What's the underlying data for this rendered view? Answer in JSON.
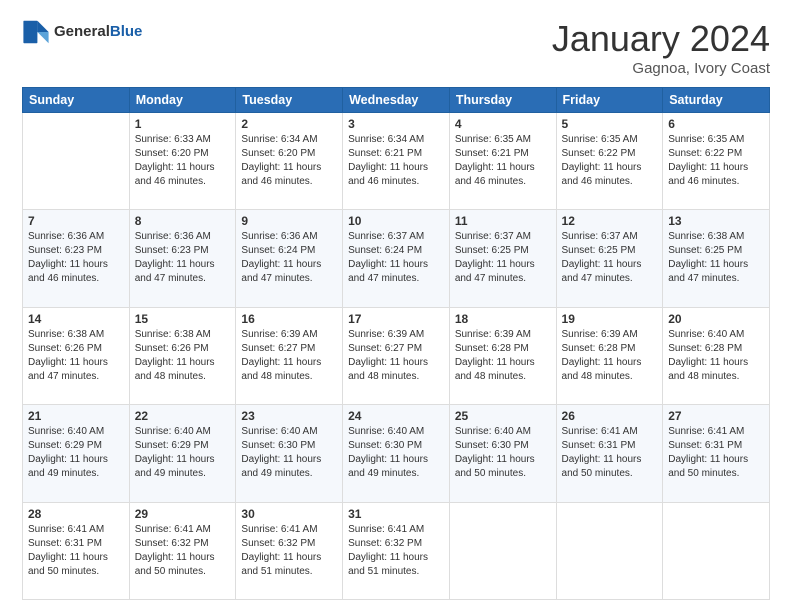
{
  "header": {
    "logo_general": "General",
    "logo_blue": "Blue",
    "title": "January 2024",
    "location": "Gagnoa, Ivory Coast"
  },
  "weekdays": [
    "Sunday",
    "Monday",
    "Tuesday",
    "Wednesday",
    "Thursday",
    "Friday",
    "Saturday"
  ],
  "weeks": [
    [
      {
        "day": "",
        "info": ""
      },
      {
        "day": "1",
        "info": "Sunrise: 6:33 AM\nSunset: 6:20 PM\nDaylight: 11 hours\nand 46 minutes."
      },
      {
        "day": "2",
        "info": "Sunrise: 6:34 AM\nSunset: 6:20 PM\nDaylight: 11 hours\nand 46 minutes."
      },
      {
        "day": "3",
        "info": "Sunrise: 6:34 AM\nSunset: 6:21 PM\nDaylight: 11 hours\nand 46 minutes."
      },
      {
        "day": "4",
        "info": "Sunrise: 6:35 AM\nSunset: 6:21 PM\nDaylight: 11 hours\nand 46 minutes."
      },
      {
        "day": "5",
        "info": "Sunrise: 6:35 AM\nSunset: 6:22 PM\nDaylight: 11 hours\nand 46 minutes."
      },
      {
        "day": "6",
        "info": "Sunrise: 6:35 AM\nSunset: 6:22 PM\nDaylight: 11 hours\nand 46 minutes."
      }
    ],
    [
      {
        "day": "7",
        "info": "Sunrise: 6:36 AM\nSunset: 6:23 PM\nDaylight: 11 hours\nand 46 minutes."
      },
      {
        "day": "8",
        "info": "Sunrise: 6:36 AM\nSunset: 6:23 PM\nDaylight: 11 hours\nand 47 minutes."
      },
      {
        "day": "9",
        "info": "Sunrise: 6:36 AM\nSunset: 6:24 PM\nDaylight: 11 hours\nand 47 minutes."
      },
      {
        "day": "10",
        "info": "Sunrise: 6:37 AM\nSunset: 6:24 PM\nDaylight: 11 hours\nand 47 minutes."
      },
      {
        "day": "11",
        "info": "Sunrise: 6:37 AM\nSunset: 6:25 PM\nDaylight: 11 hours\nand 47 minutes."
      },
      {
        "day": "12",
        "info": "Sunrise: 6:37 AM\nSunset: 6:25 PM\nDaylight: 11 hours\nand 47 minutes."
      },
      {
        "day": "13",
        "info": "Sunrise: 6:38 AM\nSunset: 6:25 PM\nDaylight: 11 hours\nand 47 minutes."
      }
    ],
    [
      {
        "day": "14",
        "info": "Sunrise: 6:38 AM\nSunset: 6:26 PM\nDaylight: 11 hours\nand 47 minutes."
      },
      {
        "day": "15",
        "info": "Sunrise: 6:38 AM\nSunset: 6:26 PM\nDaylight: 11 hours\nand 48 minutes."
      },
      {
        "day": "16",
        "info": "Sunrise: 6:39 AM\nSunset: 6:27 PM\nDaylight: 11 hours\nand 48 minutes."
      },
      {
        "day": "17",
        "info": "Sunrise: 6:39 AM\nSunset: 6:27 PM\nDaylight: 11 hours\nand 48 minutes."
      },
      {
        "day": "18",
        "info": "Sunrise: 6:39 AM\nSunset: 6:28 PM\nDaylight: 11 hours\nand 48 minutes."
      },
      {
        "day": "19",
        "info": "Sunrise: 6:39 AM\nSunset: 6:28 PM\nDaylight: 11 hours\nand 48 minutes."
      },
      {
        "day": "20",
        "info": "Sunrise: 6:40 AM\nSunset: 6:28 PM\nDaylight: 11 hours\nand 48 minutes."
      }
    ],
    [
      {
        "day": "21",
        "info": "Sunrise: 6:40 AM\nSunset: 6:29 PM\nDaylight: 11 hours\nand 49 minutes."
      },
      {
        "day": "22",
        "info": "Sunrise: 6:40 AM\nSunset: 6:29 PM\nDaylight: 11 hours\nand 49 minutes."
      },
      {
        "day": "23",
        "info": "Sunrise: 6:40 AM\nSunset: 6:30 PM\nDaylight: 11 hours\nand 49 minutes."
      },
      {
        "day": "24",
        "info": "Sunrise: 6:40 AM\nSunset: 6:30 PM\nDaylight: 11 hours\nand 49 minutes."
      },
      {
        "day": "25",
        "info": "Sunrise: 6:40 AM\nSunset: 6:30 PM\nDaylight: 11 hours\nand 50 minutes."
      },
      {
        "day": "26",
        "info": "Sunrise: 6:41 AM\nSunset: 6:31 PM\nDaylight: 11 hours\nand 50 minutes."
      },
      {
        "day": "27",
        "info": "Sunrise: 6:41 AM\nSunset: 6:31 PM\nDaylight: 11 hours\nand 50 minutes."
      }
    ],
    [
      {
        "day": "28",
        "info": "Sunrise: 6:41 AM\nSunset: 6:31 PM\nDaylight: 11 hours\nand 50 minutes."
      },
      {
        "day": "29",
        "info": "Sunrise: 6:41 AM\nSunset: 6:32 PM\nDaylight: 11 hours\nand 50 minutes."
      },
      {
        "day": "30",
        "info": "Sunrise: 6:41 AM\nSunset: 6:32 PM\nDaylight: 11 hours\nand 51 minutes."
      },
      {
        "day": "31",
        "info": "Sunrise: 6:41 AM\nSunset: 6:32 PM\nDaylight: 11 hours\nand 51 minutes."
      },
      {
        "day": "",
        "info": ""
      },
      {
        "day": "",
        "info": ""
      },
      {
        "day": "",
        "info": ""
      }
    ]
  ]
}
